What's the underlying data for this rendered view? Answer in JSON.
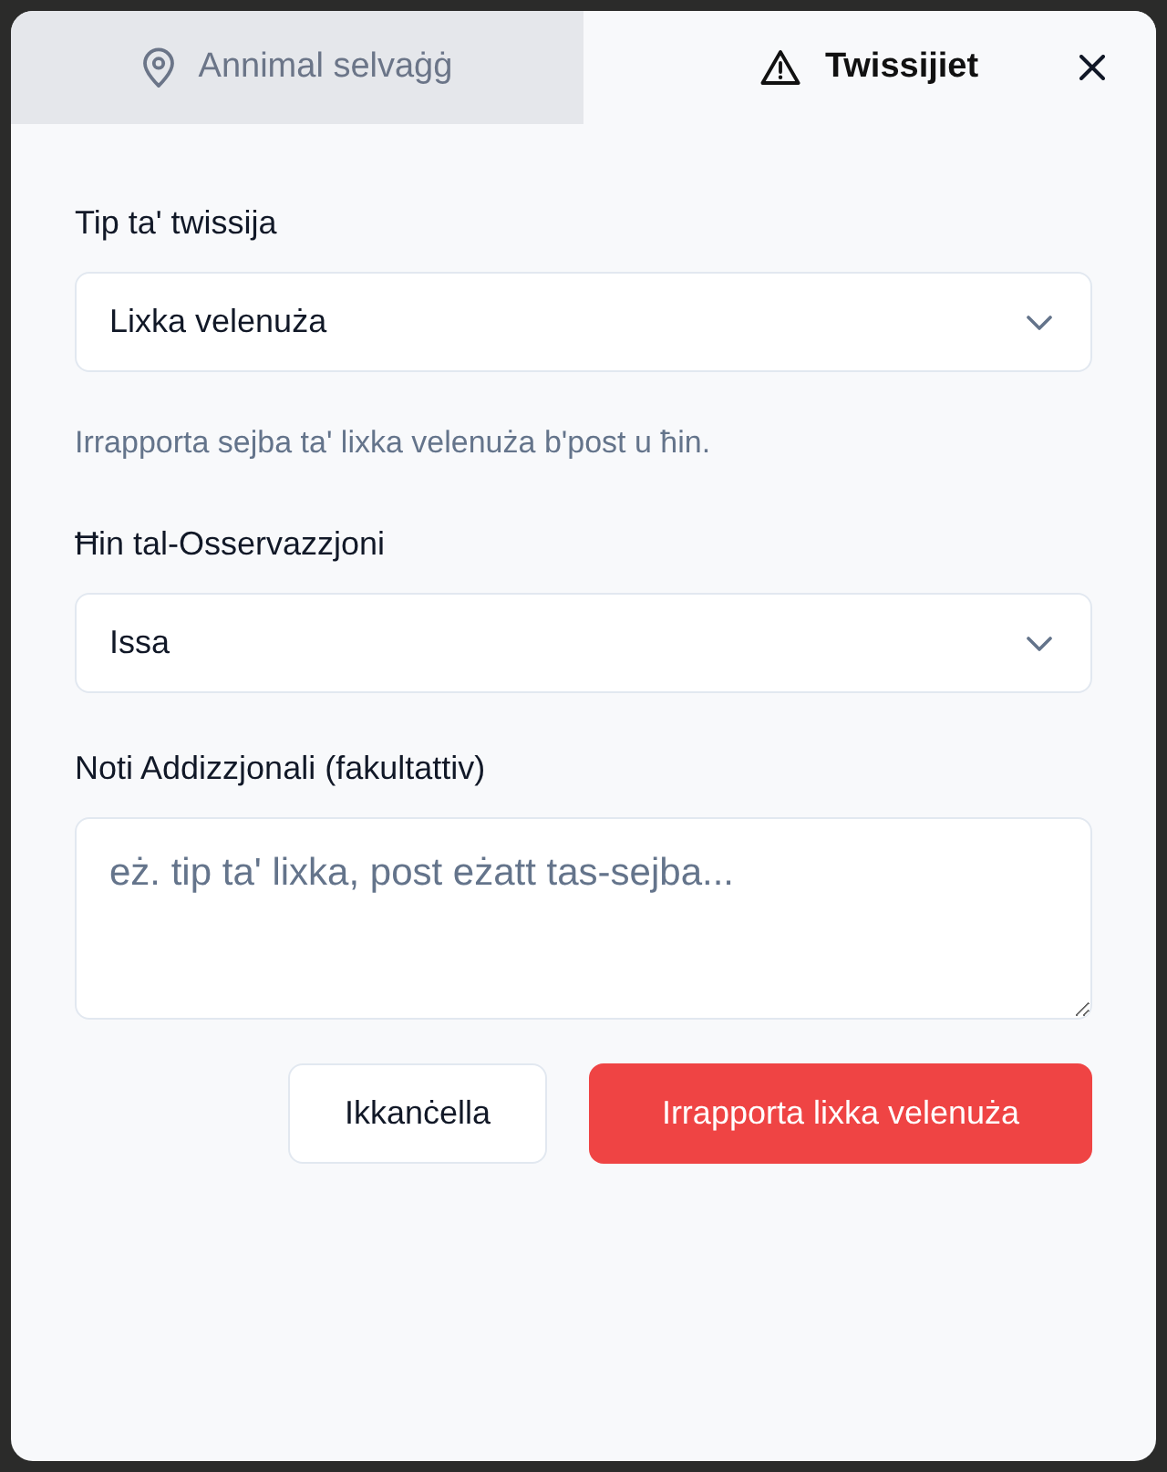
{
  "tabs": [
    {
      "label": "Annimal selvaġġ",
      "selected": false
    },
    {
      "label": "Twissijiet",
      "selected": true
    }
  ],
  "form": {
    "fields": [
      {
        "kind": "select",
        "label": "Tip ta' twissija",
        "value": "Lixka velenuża",
        "help": "Irrapporta sejba ta' lixka velenuża b'post u ħin."
      },
      {
        "kind": "select",
        "label": "Ħin tal-Osservazzjoni",
        "value": "Issa"
      },
      {
        "kind": "textarea",
        "label": "Noti Addizzjonali (fakultattiv)",
        "placeholder": "eż. tip ta' lixka, post eżatt tas-sejba..."
      }
    ]
  },
  "buttons": [
    {
      "kind": "secondary",
      "label": "Ikkanċella"
    },
    {
      "kind": "primary",
      "label": "Irrapporta lixka velenuża"
    }
  ]
}
